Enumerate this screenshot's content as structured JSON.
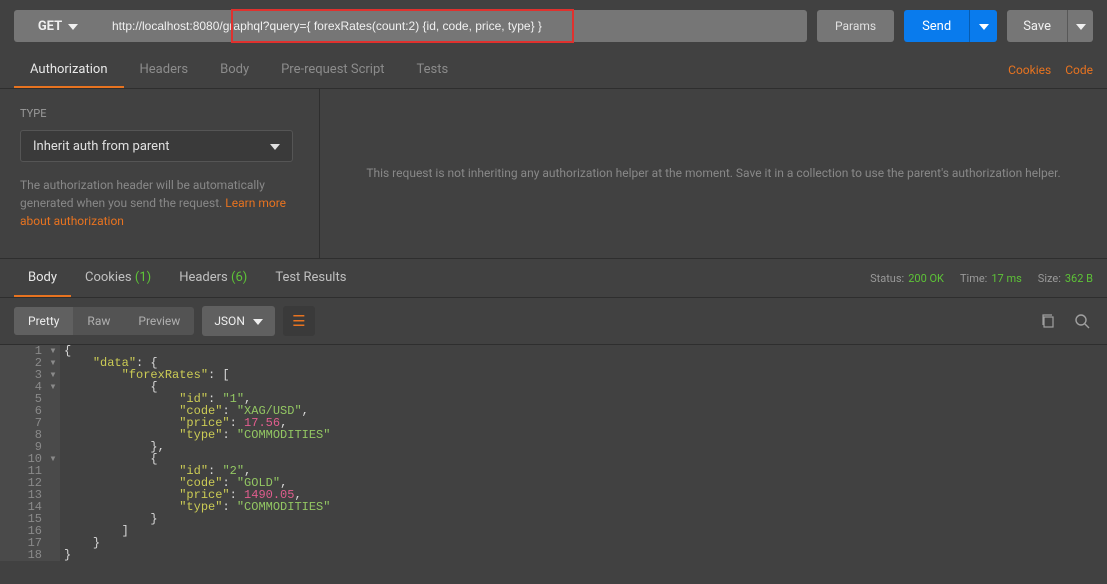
{
  "request": {
    "method": "GET",
    "url": "http://localhost:8080/graphql?query={ forexRates(count:2) {id, code, price, type} }",
    "params_btn": "Params",
    "send_btn": "Send",
    "save_btn": "Save"
  },
  "tabs": {
    "authorization": "Authorization",
    "headers": "Headers",
    "body": "Body",
    "prerequest": "Pre-request Script",
    "tests": "Tests",
    "cookies": "Cookies",
    "code": "Code"
  },
  "auth": {
    "type_label": "TYPE",
    "type_value": "Inherit auth from parent",
    "desc_prefix": "The authorization header will be automatically generated when you send the request. ",
    "desc_link": "Learn more about authorization",
    "right_msg": "This request is not inheriting any authorization helper at the moment. Save it in a collection to use the parent's authorization helper."
  },
  "response_tabs": {
    "body": "Body",
    "cookies": "Cookies",
    "cookies_count": "(1)",
    "headers": "Headers",
    "headers_count": "(6)",
    "test_results": "Test Results"
  },
  "response_meta": {
    "status_label": "Status:",
    "status_value": "200 OK",
    "time_label": "Time:",
    "time_value": "17 ms",
    "size_label": "Size:",
    "size_value": "362 B"
  },
  "viewer": {
    "pretty": "Pretty",
    "raw": "Raw",
    "preview": "Preview",
    "format": "JSON"
  },
  "json_body": {
    "data": {
      "forexRates": [
        {
          "id": "1",
          "code": "XAG/USD",
          "price": 17.56,
          "type": "COMMODITIES"
        },
        {
          "id": "2",
          "code": "GOLD",
          "price": 1490.05,
          "type": "COMMODITIES"
        }
      ]
    }
  }
}
